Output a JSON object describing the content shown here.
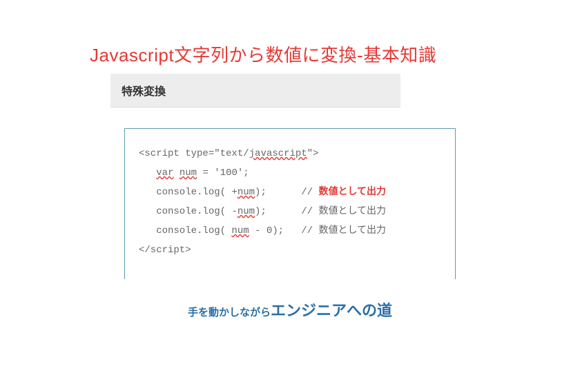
{
  "title": "Javascript文字列から数値に変換-基本知識",
  "section_header": "特殊変換",
  "code": {
    "open_tag_pre": "<script type=\"text/",
    "open_tag_js": "javascript",
    "open_tag_post": "\">",
    "line1_pre": "   ",
    "line1_var": "var",
    "line1_mid": " ",
    "line1_num": "num",
    "line1_post": " = '100';",
    "line2_pre": "   console.log( +",
    "line2_num": "num",
    "line2_post": ");      // ",
    "line2_comment": "数値として出力",
    "line3_pre": "   console.log( -",
    "line3_num": "num",
    "line3_post": ");      // 数値として出力",
    "line4_pre": "   console.log( ",
    "line4_num": "num",
    "line4_post": " - 0);   // 数値として出力",
    "close_tag": "</script>"
  },
  "footer": {
    "small": "手を動かしながら",
    "big": "エンジニアへの道"
  }
}
